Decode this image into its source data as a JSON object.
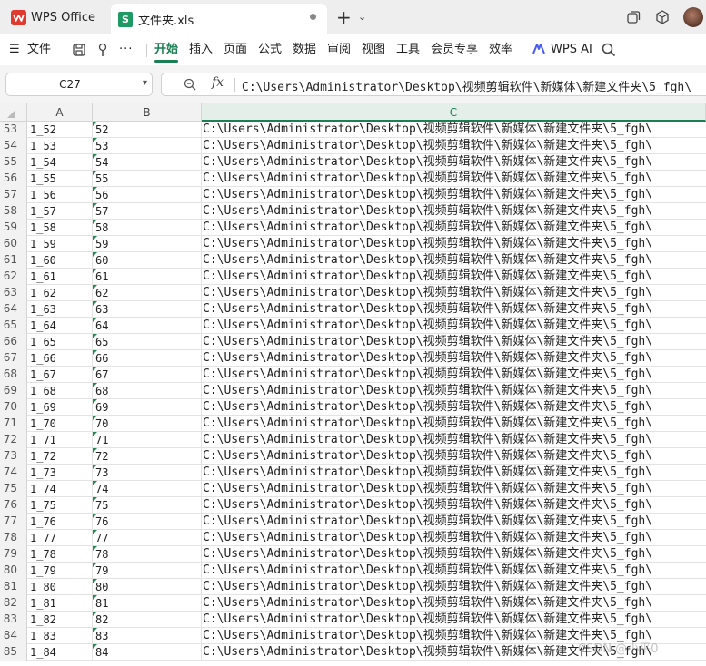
{
  "titlebar": {
    "app_title": "WPS Office",
    "file_tab_icon_letter": "S",
    "file_tab_title": "文件夹.xls"
  },
  "ribbon": {
    "menu_label": "文件",
    "tabs": [
      "开始",
      "插入",
      "页面",
      "公式",
      "数据",
      "审阅",
      "视图",
      "工具",
      "会员专享",
      "效率"
    ],
    "active_tab": "开始",
    "ai_label": "WPS AI"
  },
  "formula_bar": {
    "cell_ref": "C27",
    "fx_label": "fx",
    "content": "C:\\Users\\Administrator\\Desktop\\视频剪辑软件\\新媒体\\新建文件夹\\5_fgh\\"
  },
  "sheet": {
    "columns": [
      "A",
      "B",
      "C"
    ],
    "selected_column": "C",
    "rows": [
      {
        "n": "53",
        "a": "1_52",
        "b": "52",
        "c": "C:\\Users\\Administrator\\Desktop\\视频剪辑软件\\新媒体\\新建文件夹\\5_fgh\\"
      },
      {
        "n": "54",
        "a": "1_53",
        "b": "53",
        "c": "C:\\Users\\Administrator\\Desktop\\视频剪辑软件\\新媒体\\新建文件夹\\5_fgh\\"
      },
      {
        "n": "55",
        "a": "1_54",
        "b": "54",
        "c": "C:\\Users\\Administrator\\Desktop\\视频剪辑软件\\新媒体\\新建文件夹\\5_fgh\\"
      },
      {
        "n": "56",
        "a": "1_55",
        "b": "55",
        "c": "C:\\Users\\Administrator\\Desktop\\视频剪辑软件\\新媒体\\新建文件夹\\5_fgh\\"
      },
      {
        "n": "57",
        "a": "1_56",
        "b": "56",
        "c": "C:\\Users\\Administrator\\Desktop\\视频剪辑软件\\新媒体\\新建文件夹\\5_fgh\\"
      },
      {
        "n": "58",
        "a": "1_57",
        "b": "57",
        "c": "C:\\Users\\Administrator\\Desktop\\视频剪辑软件\\新媒体\\新建文件夹\\5_fgh\\"
      },
      {
        "n": "59",
        "a": "1_58",
        "b": "58",
        "c": "C:\\Users\\Administrator\\Desktop\\视频剪辑软件\\新媒体\\新建文件夹\\5_fgh\\"
      },
      {
        "n": "60",
        "a": "1_59",
        "b": "59",
        "c": "C:\\Users\\Administrator\\Desktop\\视频剪辑软件\\新媒体\\新建文件夹\\5_fgh\\"
      },
      {
        "n": "61",
        "a": "1_60",
        "b": "60",
        "c": "C:\\Users\\Administrator\\Desktop\\视频剪辑软件\\新媒体\\新建文件夹\\5_fgh\\"
      },
      {
        "n": "62",
        "a": "1_61",
        "b": "61",
        "c": "C:\\Users\\Administrator\\Desktop\\视频剪辑软件\\新媒体\\新建文件夹\\5_fgh\\"
      },
      {
        "n": "63",
        "a": "1_62",
        "b": "62",
        "c": "C:\\Users\\Administrator\\Desktop\\视频剪辑软件\\新媒体\\新建文件夹\\5_fgh\\"
      },
      {
        "n": "64",
        "a": "1_63",
        "b": "63",
        "c": "C:\\Users\\Administrator\\Desktop\\视频剪辑软件\\新媒体\\新建文件夹\\5_fgh\\"
      },
      {
        "n": "65",
        "a": "1_64",
        "b": "64",
        "c": "C:\\Users\\Administrator\\Desktop\\视频剪辑软件\\新媒体\\新建文件夹\\5_fgh\\"
      },
      {
        "n": "66",
        "a": "1_65",
        "b": "65",
        "c": "C:\\Users\\Administrator\\Desktop\\视频剪辑软件\\新媒体\\新建文件夹\\5_fgh\\"
      },
      {
        "n": "67",
        "a": "1_66",
        "b": "66",
        "c": "C:\\Users\\Administrator\\Desktop\\视频剪辑软件\\新媒体\\新建文件夹\\5_fgh\\"
      },
      {
        "n": "68",
        "a": "1_67",
        "b": "67",
        "c": "C:\\Users\\Administrator\\Desktop\\视频剪辑软件\\新媒体\\新建文件夹\\5_fgh\\"
      },
      {
        "n": "69",
        "a": "1_68",
        "b": "68",
        "c": "C:\\Users\\Administrator\\Desktop\\视频剪辑软件\\新媒体\\新建文件夹\\5_fgh\\"
      },
      {
        "n": "70",
        "a": "1_69",
        "b": "69",
        "c": "C:\\Users\\Administrator\\Desktop\\视频剪辑软件\\新媒体\\新建文件夹\\5_fgh\\"
      },
      {
        "n": "71",
        "a": "1_70",
        "b": "70",
        "c": "C:\\Users\\Administrator\\Desktop\\视频剪辑软件\\新媒体\\新建文件夹\\5_fgh\\"
      },
      {
        "n": "72",
        "a": "1_71",
        "b": "71",
        "c": "C:\\Users\\Administrator\\Desktop\\视频剪辑软件\\新媒体\\新建文件夹\\5_fgh\\"
      },
      {
        "n": "73",
        "a": "1_72",
        "b": "72",
        "c": "C:\\Users\\Administrator\\Desktop\\视频剪辑软件\\新媒体\\新建文件夹\\5_fgh\\"
      },
      {
        "n": "74",
        "a": "1_73",
        "b": "73",
        "c": "C:\\Users\\Administrator\\Desktop\\视频剪辑软件\\新媒体\\新建文件夹\\5_fgh\\"
      },
      {
        "n": "75",
        "a": "1_74",
        "b": "74",
        "c": "C:\\Users\\Administrator\\Desktop\\视频剪辑软件\\新媒体\\新建文件夹\\5_fgh\\"
      },
      {
        "n": "76",
        "a": "1_75",
        "b": "75",
        "c": "C:\\Users\\Administrator\\Desktop\\视频剪辑软件\\新媒体\\新建文件夹\\5_fgh\\"
      },
      {
        "n": "77",
        "a": "1_76",
        "b": "76",
        "c": "C:\\Users\\Administrator\\Desktop\\视频剪辑软件\\新媒体\\新建文件夹\\5_fgh\\"
      },
      {
        "n": "78",
        "a": "1_77",
        "b": "77",
        "c": "C:\\Users\\Administrator\\Desktop\\视频剪辑软件\\新媒体\\新建文件夹\\5_fgh\\"
      },
      {
        "n": "79",
        "a": "1_78",
        "b": "78",
        "c": "C:\\Users\\Administrator\\Desktop\\视频剪辑软件\\新媒体\\新建文件夹\\5_fgh\\"
      },
      {
        "n": "80",
        "a": "1_79",
        "b": "79",
        "c": "C:\\Users\\Administrator\\Desktop\\视频剪辑软件\\新媒体\\新建文件夹\\5_fgh\\"
      },
      {
        "n": "81",
        "a": "1_80",
        "b": "80",
        "c": "C:\\Users\\Administrator\\Desktop\\视频剪辑软件\\新媒体\\新建文件夹\\5_fgh\\"
      },
      {
        "n": "82",
        "a": "1_81",
        "b": "81",
        "c": "C:\\Users\\Administrator\\Desktop\\视频剪辑软件\\新媒体\\新建文件夹\\5_fgh\\"
      },
      {
        "n": "83",
        "a": "1_82",
        "b": "82",
        "c": "C:\\Users\\Administrator\\Desktop\\视频剪辑软件\\新媒体\\新建文件夹\\5_fgh\\"
      },
      {
        "n": "84",
        "a": "1_83",
        "b": "83",
        "c": "C:\\Users\\Administrator\\Desktop\\视频剪辑软件\\新媒体\\新建文件夹\\5_fgh\\"
      },
      {
        "n": "85",
        "a": "1_84",
        "b": "84",
        "c": "C:\\Users\\Administrator\\Desktop\\视频剪辑软件\\新媒体\\新建文件夹\\5_fgh\\"
      }
    ]
  },
  "watermark": "CSDN @小平0",
  "colors": {
    "accent": "#1a7f52",
    "wps_red": "#e03a2f",
    "sheet_icon": "#1f9a64"
  }
}
